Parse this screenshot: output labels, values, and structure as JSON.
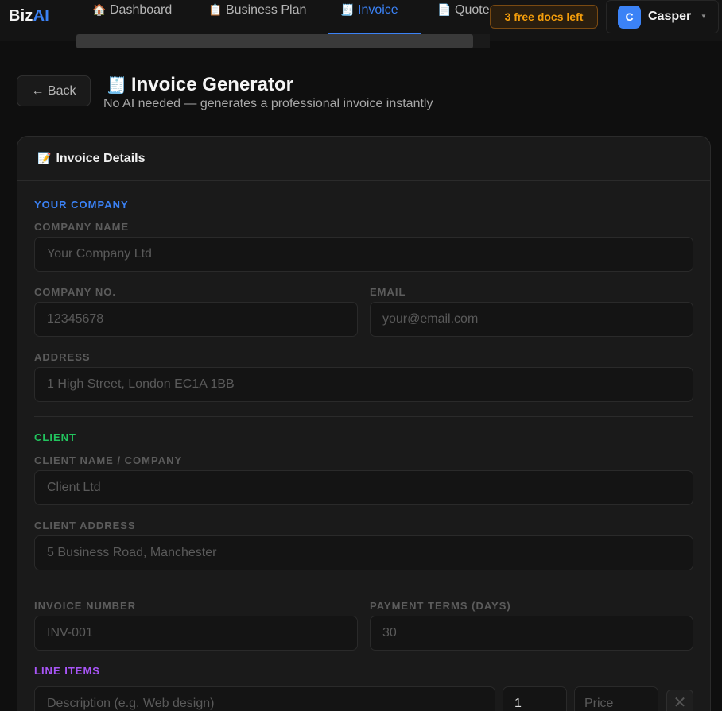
{
  "app": {
    "logo_main": "Biz",
    "logo_accent": "AI"
  },
  "nav": {
    "tabs": [
      {
        "label": "Dashboard",
        "icon": "🏠"
      },
      {
        "label": "Business Plan",
        "icon": "📋"
      },
      {
        "label": "Invoice",
        "icon": "🧾"
      },
      {
        "label": "Quote",
        "icon": "📄"
      }
    ],
    "active": "Invoice"
  },
  "header": {
    "docs_left": "3 free docs left",
    "user_initial": "C",
    "user_name": "Casper",
    "caret": "▼"
  },
  "page": {
    "back_label": "← Back",
    "title_icon": "🧾",
    "title": "Invoice Generator",
    "subtitle": "No AI needed — generates a professional invoice instantly"
  },
  "card": {
    "icon": "📝",
    "title": "Invoice Details"
  },
  "form": {
    "your_company_heading": "YOUR COMPANY",
    "company_name_label": "COMPANY NAME",
    "company_name_placeholder": "Your Company Ltd",
    "company_no_label": "COMPANY NO.",
    "company_no_placeholder": "12345678",
    "email_label": "EMAIL",
    "email_placeholder": "your@email.com",
    "address_label": "ADDRESS",
    "address_placeholder": "1 High Street, London EC1A 1BB",
    "client_heading": "CLIENT",
    "client_name_label": "CLIENT NAME / COMPANY",
    "client_name_placeholder": "Client Ltd",
    "client_address_label": "CLIENT ADDRESS",
    "client_address_placeholder": "5 Business Road, Manchester",
    "invoice_number_label": "INVOICE NUMBER",
    "invoice_number_placeholder": "INV-001",
    "payment_terms_label": "PAYMENT TERMS (DAYS)",
    "payment_terms_placeholder": "30",
    "line_items_heading": "LINE ITEMS",
    "line_item": {
      "description_placeholder": "Description (e.g. Web design)",
      "quantity_value": "1",
      "price_placeholder": "Price",
      "remove_symbol": "✕"
    }
  },
  "colors": {
    "accent_blue": "#3b82f6",
    "client_green": "#22c55e",
    "line_items_purple": "#a855f7",
    "badge_orange": "#f59e0b"
  }
}
